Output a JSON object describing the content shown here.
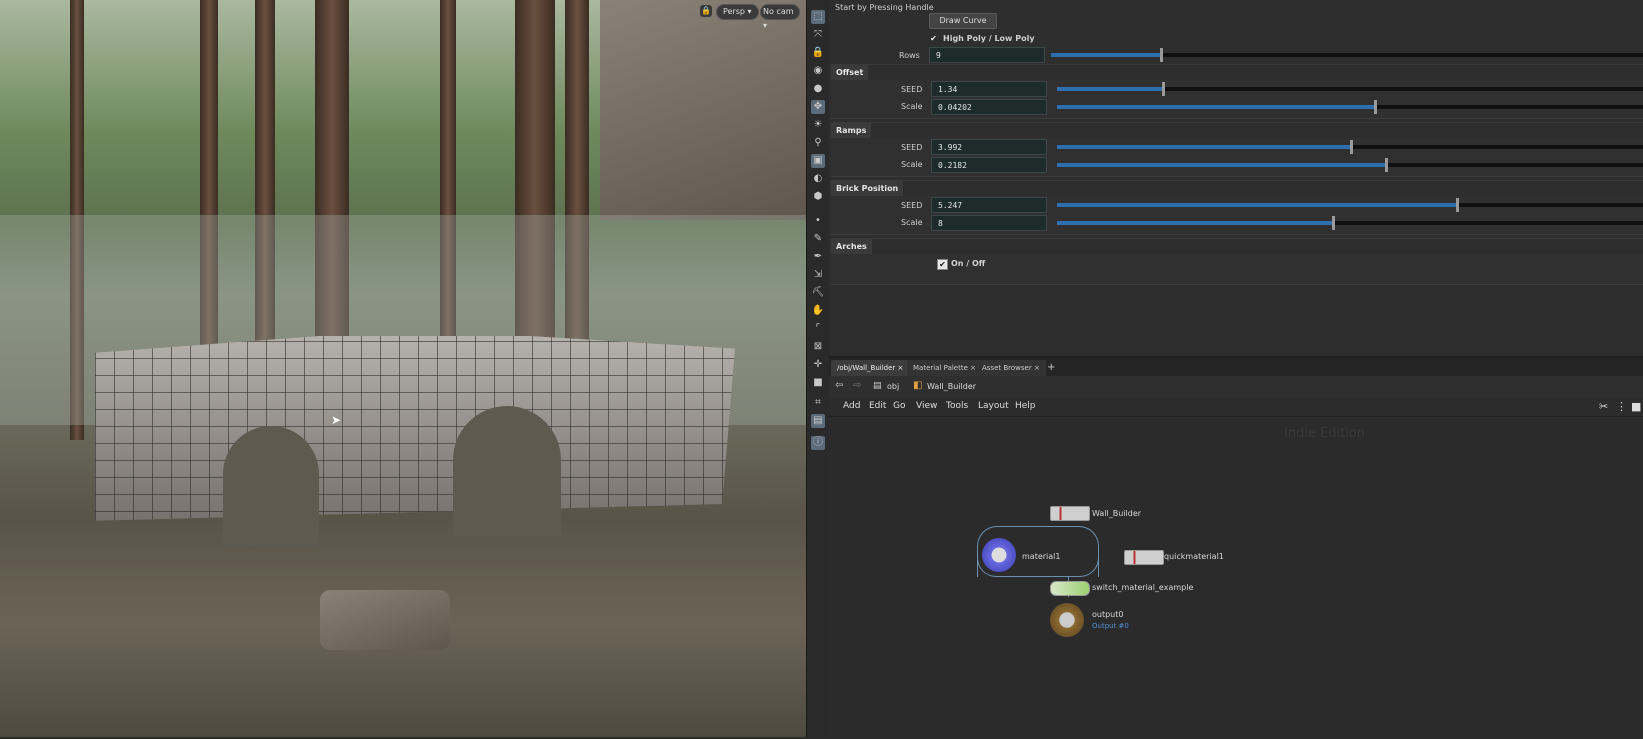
{
  "viewport": {
    "view_menu": "Persp",
    "camera_menu": "No cam"
  },
  "params": {
    "start_text": "Start by Pressing Handle",
    "draw_curve": "Draw Curve",
    "poly_toggle": "High Poly / Low Poly",
    "rows_label": "Rows",
    "rows_value": "9",
    "rows_fraction": 0.185,
    "offset": {
      "title": "Offset",
      "seed_label": "SEED",
      "seed_value": "1.34",
      "seed_fraction": 0.18,
      "scale_label": "Scale",
      "scale_value": "0.04202",
      "scale_fraction": 0.54
    },
    "ramps": {
      "title": "Ramps",
      "seed_label": "SEED",
      "seed_value": "3.992",
      "seed_fraction": 0.5,
      "scale_label": "Scale",
      "scale_value": "0.2182",
      "scale_fraction": 0.56
    },
    "brick_position": {
      "title": "Brick Position",
      "seed_label": "SEED",
      "seed_value": "5.247",
      "seed_fraction": 0.68,
      "scale_label": "Scale",
      "scale_value": "8",
      "scale_fraction": 0.47
    },
    "arches": {
      "title": "Arches",
      "toggle_label": "On / Off"
    }
  },
  "network": {
    "tabs": [
      "/obj/Wall_Builder",
      "Material Palette",
      "Asset Browser"
    ],
    "path": {
      "root": "obj",
      "current": "Wall_Builder"
    },
    "menu": [
      "Add",
      "Edit",
      "Go",
      "View",
      "Tools",
      "Layout",
      "Help"
    ],
    "watermark": "Indie Edition",
    "nodes": {
      "wall_builder": "Wall_Builder",
      "material": "material1",
      "quickmaterial": "quickmaterial1",
      "switch": "switch_material_example",
      "output": "output0",
      "output_sub": "Output #0"
    }
  },
  "colors": {
    "slider_fill": "#2f6fb0",
    "field_bg": "#1d2b2b",
    "panel_bg": "#2e2e2e"
  }
}
